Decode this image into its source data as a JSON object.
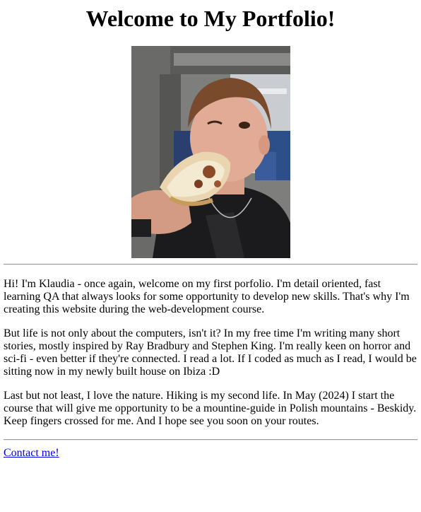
{
  "page": {
    "heading": "Welcome to My Portfolio!",
    "photo": {
      "subject": "person eating a slice of pizza",
      "icon": "portrait-photo"
    },
    "paragraphs": [
      "Hi! I'm Klaudia - once again, welcome on my first porfolio. I'm detail oriented, fast learning QA that always looks for some opportunity to develop new skills. That's why I'm creating this website during the web-development course.",
      "But life is not only about the computers, isn't it? In my free time I'm writing many short stories, mostly inspired by Ray Bradbury and Stephen King. I'm really keen on horror and sci-fi - even better if they're connected. I read a lot. If I coded as much as I read, I would be sitting now in my newly built house on Ibiza :D",
      "Last but not least, I love the nature. Hiking is my second life. In May (2024) I start the course that will give me opportunity to be a mountine-guide in Polish mountains - Beskidy. Keep fingers crossed for me. And I hope see you soon on your routes."
    ],
    "contact_link": "Contact me!",
    "colors": {
      "link": "#0000ee",
      "text": "#000000",
      "background": "#ffffff"
    }
  }
}
